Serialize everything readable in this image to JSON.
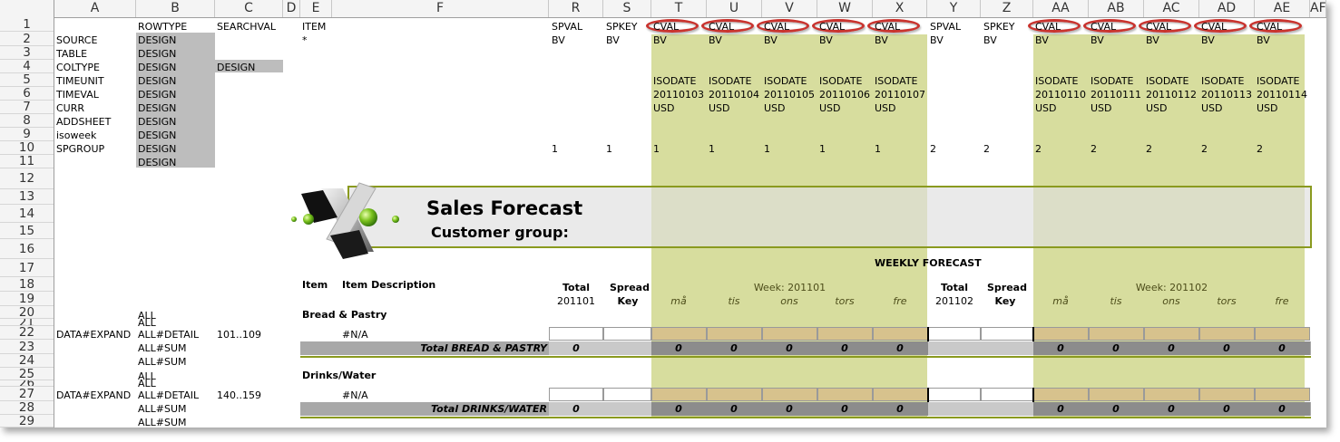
{
  "columns": [
    "A",
    "B",
    "C",
    "D",
    "E",
    "F",
    "R",
    "S",
    "T",
    "U",
    "V",
    "W",
    "X",
    "Y",
    "Z",
    "AA",
    "AB",
    "AC",
    "AD",
    "AE",
    "AF"
  ],
  "rows": [
    "1",
    "2",
    "3",
    "4",
    "5",
    "6",
    "7",
    "8",
    "9",
    "10",
    "11",
    "12",
    "13",
    "14",
    "15",
    "16",
    "17",
    "18",
    "19",
    "20",
    "21",
    "22",
    "23",
    "24",
    "25",
    "26",
    "27",
    "28",
    "29"
  ],
  "design_rows": {
    "labels": [
      "SOURCE",
      "TABLE",
      "COLTYPE",
      "TIMEUNIT",
      "TIMEVAL",
      "CURR",
      "ADDSHEET",
      "isoweek",
      "SPGROUP"
    ],
    "rowtype_header": "ROWTYPE",
    "searchval_header": "SEARCHVAL",
    "item_header": "ITEM",
    "design_value": "DESIGN",
    "coltype_searchval": "DESIGN",
    "source_item": "*"
  },
  "week1_block": {
    "spval": "SPVAL",
    "spkey": "SPKEY",
    "bv": "BV",
    "cval": "CVAL",
    "isodate": "ISODATE",
    "dates": [
      "20110103",
      "20110104",
      "20110105",
      "20110106",
      "20110107"
    ],
    "curr": "USD",
    "group": "1",
    "total_label": "Total",
    "total_period": "201101",
    "spread_label": "Spread",
    "spread_key": "Key",
    "week_label": "Week: 201101",
    "days": [
      "må",
      "tis",
      "ons",
      "tors",
      "fre"
    ]
  },
  "week2_block": {
    "spval": "SPVAL",
    "spkey": "SPKEY",
    "bv": "BV",
    "cval": "CVAL",
    "isodate": "ISODATE",
    "dates": [
      "20110110",
      "20110111",
      "20110112",
      "20110113",
      "20110114"
    ],
    "curr": "USD",
    "group": "2",
    "total_label": "Total",
    "total_period": "201102",
    "spread_label": "Spread",
    "spread_key": "Key",
    "week_label": "Week: 201102",
    "days": [
      "må",
      "tis",
      "ons",
      "tors",
      "fre"
    ]
  },
  "banner": {
    "title": "Sales Forecast",
    "subtitle": "Customer group:",
    "weekly": "WEEKLY FORECAST"
  },
  "table_header": {
    "item": "Item",
    "description": "Item Description"
  },
  "groups": [
    {
      "name": "Bread & Pastry",
      "all_a": "ALL",
      "all_b": "ALL",
      "expand": "DATA#EXPAND",
      "detail": "ALL#DETAIL",
      "range": "101..109",
      "na": "#N/A",
      "sum1": "ALL#SUM",
      "sum2": "ALL#SUM",
      "total_label": "Total BREAD & PASTRY",
      "zero": "0"
    },
    {
      "name": "Drinks/Water",
      "all_a": "ALL",
      "all_b": "ALL",
      "expand": "DATA#EXPAND",
      "detail": "ALL#DETAIL",
      "range": "140..159",
      "na": "#N/A",
      "sum1": "ALL#SUM",
      "sum2": "ALL#SUM",
      "total_label": "Total DRINKS/WATER",
      "zero": "0"
    }
  ],
  "colors": {
    "green": "#d7dd9e",
    "grey": "#bdbdbd",
    "olive": "#8a9a1f",
    "cval_ring": "#c9332e",
    "tan": "#d7c28d"
  }
}
